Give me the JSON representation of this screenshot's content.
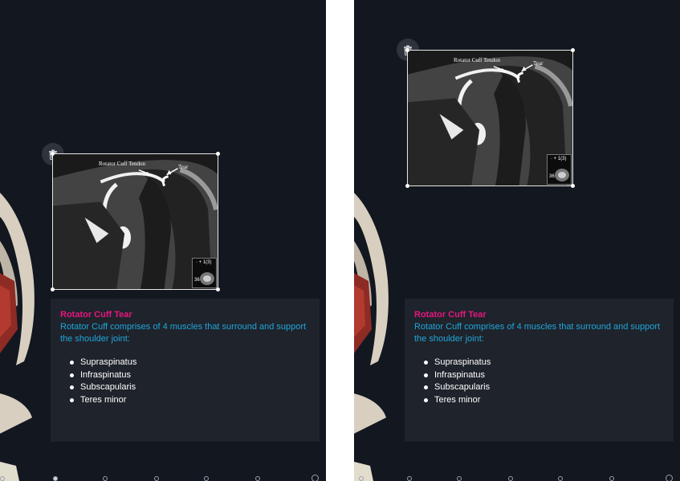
{
  "screens": [
    {
      "id": "left",
      "mri": {
        "label_tendon": "Rotator Cuff Tendon",
        "label_tear": "Tear",
        "inset_label": "·  +  1(3)",
        "inset_small": "36"
      },
      "card": {
        "title": "Rotator Cuff Tear",
        "description": "Rotator Cuff comprises of 4 muscles that surround and support the shoulder joint:",
        "items": [
          "Supraspinatus",
          "Infraspinatus",
          "Subscapularis",
          "Teres minor"
        ]
      }
    },
    {
      "id": "right",
      "mri": {
        "label_tendon": "Rotator Cuff Tendon",
        "label_tear": "Tear",
        "inset_label": "·  +  1(3)",
        "inset_small": "36"
      },
      "card": {
        "title": "Rotator Cuff Tear",
        "description": "Rotator Cuff comprises of 4 muscles that surround and support the shoulder joint:",
        "items": [
          "Supraspinatus",
          "Infraspinatus",
          "Subscapularis",
          "Teres minor"
        ]
      }
    }
  ],
  "icons": {
    "delete": "trash-icon"
  },
  "colors": {
    "background": "#121720",
    "card": "#1f232b",
    "title": "#e5177e",
    "description": "#1fa7dc",
    "list_text": "#ffffff"
  }
}
